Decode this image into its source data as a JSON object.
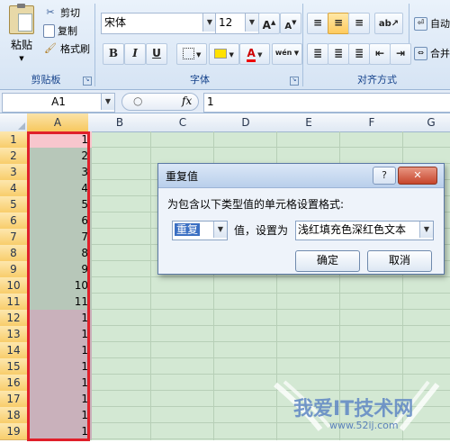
{
  "ribbon": {
    "clipboard": {
      "paste": "粘贴",
      "cut": "剪切",
      "copy": "复制",
      "format_painter": "格式刷",
      "group_label": "剪贴板"
    },
    "font": {
      "font_name": "宋体",
      "font_size": "12",
      "grow": "A",
      "shrink": "A",
      "bold": "B",
      "italic": "I",
      "underline": "U",
      "font_color_glyph": "A",
      "phonetic": "wén",
      "group_label": "字体"
    },
    "alignment": {
      "wrap_text": "自动",
      "merge": "合并",
      "group_label": "对齐方式"
    }
  },
  "formula_bar": {
    "name_box": "A1",
    "fx": "fx",
    "value": "1"
  },
  "columns": [
    "A",
    "B",
    "C",
    "D",
    "E",
    "F",
    "G"
  ],
  "rows": [
    {
      "n": "1",
      "v": "1",
      "fill": "#f7c6cd"
    },
    {
      "n": "2",
      "v": "2",
      "fill": "#b7c7b9"
    },
    {
      "n": "3",
      "v": "3",
      "fill": "#b7c7b9"
    },
    {
      "n": "4",
      "v": "4",
      "fill": "#b7c7b9"
    },
    {
      "n": "5",
      "v": "5",
      "fill": "#b7c7b9"
    },
    {
      "n": "6",
      "v": "6",
      "fill": "#b7c7b9"
    },
    {
      "n": "7",
      "v": "7",
      "fill": "#b7c7b9"
    },
    {
      "n": "8",
      "v": "8",
      "fill": "#b7c7b9"
    },
    {
      "n": "9",
      "v": "9",
      "fill": "#b7c7b9"
    },
    {
      "n": "10",
      "v": "10",
      "fill": "#b7c7b9"
    },
    {
      "n": "11",
      "v": "11",
      "fill": "#b7c7b9"
    },
    {
      "n": "12",
      "v": "1",
      "fill": "#c9b1bb"
    },
    {
      "n": "13",
      "v": "1",
      "fill": "#c9b1bb"
    },
    {
      "n": "14",
      "v": "1",
      "fill": "#c9b1bb"
    },
    {
      "n": "15",
      "v": "1",
      "fill": "#c9b1bb"
    },
    {
      "n": "16",
      "v": "1",
      "fill": "#c9b1bb"
    },
    {
      "n": "17",
      "v": "1",
      "fill": "#c9b1bb"
    },
    {
      "n": "18",
      "v": "1",
      "fill": "#c9b1bb"
    },
    {
      "n": "19",
      "v": "1",
      "fill": "#c9b1bb"
    }
  ],
  "dialog": {
    "title": "重复值",
    "help": "?",
    "close": "✕",
    "instruction": "为包含以下类型值的单元格设置格式:",
    "type_value": "重复",
    "mid_label": "值，设置为",
    "format_value": "浅红填充色深红色文本",
    "ok": "确定",
    "cancel": "取消"
  },
  "watermark": {
    "text": "我爱IT技术网",
    "url": "www.52ij.com"
  },
  "colors": {
    "selection_border": "#e0202a",
    "grid_bg": "#d3e8d3",
    "accent_header": "#f8cd6b"
  }
}
